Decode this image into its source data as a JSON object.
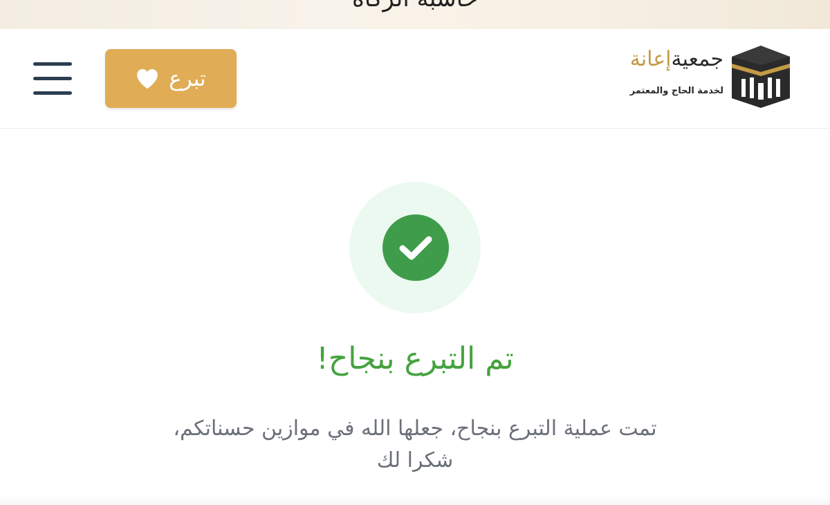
{
  "top_banner": {
    "text": "حاسبة الزكاة"
  },
  "header": {
    "donate_label": "تبرع",
    "logo": {
      "name_part1": "جمعية",
      "name_part2": "إعانة",
      "subtitle": "لخدمة الحاج والمعتمر"
    }
  },
  "success": {
    "title": "تم التبرع بنجاح!",
    "message_line1": "تمت عملية التبرع بنجاح، جعلها الله في موازين حسناتكم،",
    "message_line2": "شكرا لك"
  },
  "icons": {
    "menu": "hamburger-menu-icon",
    "donate": "heart-icon",
    "success": "check-circle-icon",
    "logo": "kaaba-logo-icon"
  },
  "colors": {
    "accent_gold": "#e0ad56",
    "success_green": "#45a33e",
    "success_bg": "#ebf9f1",
    "nav_dark": "#2c3e50"
  }
}
